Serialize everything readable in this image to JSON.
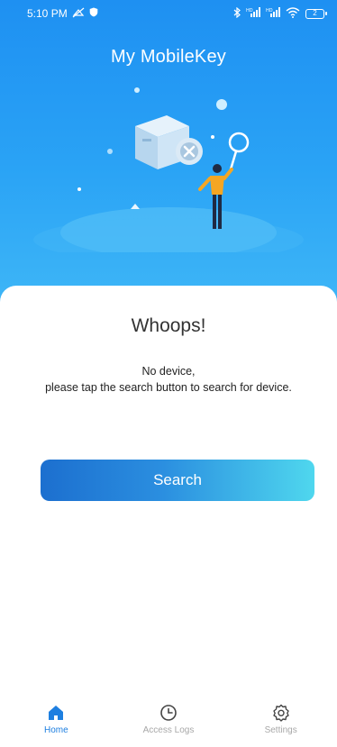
{
  "status_bar": {
    "time": "5:10 PM",
    "battery": "2"
  },
  "header": {
    "title": "My MobileKey"
  },
  "empty_state": {
    "headline": "Whoops!",
    "line1": "No device,",
    "line2": "please tap the search button to search for device."
  },
  "actions": {
    "search_label": "Search"
  },
  "tabs": [
    {
      "label": "Home",
      "icon": "home-icon",
      "active": true
    },
    {
      "label": "Access Logs",
      "icon": "clock-icon",
      "active": false
    },
    {
      "label": "Settings",
      "icon": "gear-icon",
      "active": false
    }
  ],
  "colors": {
    "hero_top": "#1e90f2",
    "hero_bottom": "#3eb6f7",
    "accent": "#1e7fe0",
    "button_start": "#1c6fcf",
    "button_end": "#4fd7ee",
    "tab_inactive": "#a8a8a8"
  }
}
